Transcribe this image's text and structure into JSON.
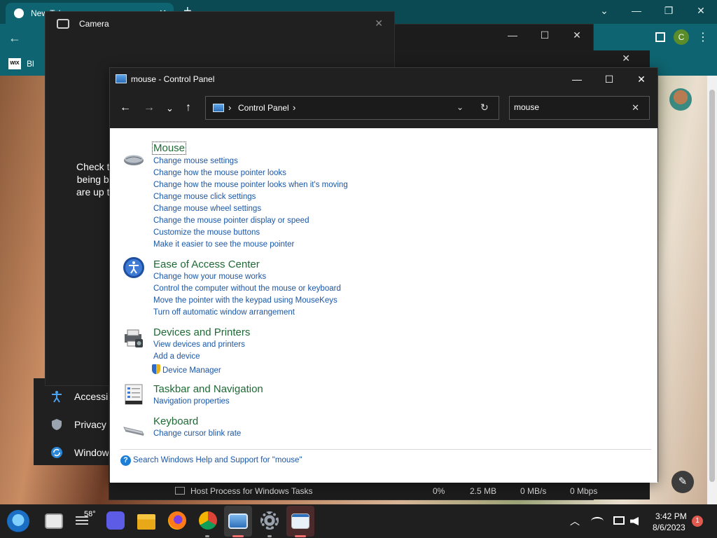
{
  "browser": {
    "tab_title": "New Tab",
    "new_tab": "+",
    "window_buttons": [
      "⌄",
      "—",
      "❐",
      "✕"
    ],
    "back": "←",
    "profile_initial": "C",
    "bookmark_wix": "WIX",
    "bookmark_label": "Bl",
    "menu": "⋮",
    "edit_icon": "✎"
  },
  "camera": {
    "title": "Camera",
    "close": "✕",
    "message_lines": [
      "Check t",
      "being b",
      "are up t"
    ]
  },
  "settings_items": [
    {
      "label": "Accessib",
      "icon": "accessibility-icon"
    },
    {
      "label": "Privacy",
      "icon": "shield-icon"
    },
    {
      "label": "Window",
      "icon": "update-icon"
    }
  ],
  "task_manager": {
    "window_buttons": [
      "—",
      "☐",
      "✕"
    ],
    "close2": "✕",
    "row": {
      "name": "Host Process for Windows Tasks",
      "cpu": "0%",
      "memory": "2.5 MB",
      "disk": "0 MB/s",
      "network": "0 Mbps"
    }
  },
  "control_panel": {
    "title": "mouse - Control Panel",
    "window_buttons": [
      "—",
      "☐",
      "✕"
    ],
    "nav": {
      "back": "←",
      "forward": "→",
      "recent": "⌄",
      "up": "↑"
    },
    "breadcrumb": {
      "sep": "›",
      "location": "Control Panel",
      "sep2": "›",
      "dropdown": "⌄",
      "refresh": "↻"
    },
    "search": {
      "value": "mouse",
      "clear": "✕"
    },
    "results": [
      {
        "title": "Mouse",
        "icon": "mouse-icon",
        "links": [
          "Change mouse settings",
          "Change how the mouse pointer looks",
          "Change how the mouse pointer looks when it's moving",
          "Change mouse click settings",
          "Change mouse wheel settings",
          "Change the mouse pointer display or speed",
          "Customize the mouse buttons",
          "Make it easier to see the mouse pointer"
        ]
      },
      {
        "title": "Ease of Access Center",
        "icon": "ease-of-access-icon",
        "links": [
          "Change how your mouse works",
          "Control the computer without the mouse or keyboard",
          "Move the pointer with the keypad using MouseKeys",
          "Turn off automatic window arrangement"
        ]
      },
      {
        "title": "Devices and Printers",
        "icon": "printer-icon",
        "links": [
          "View devices and printers",
          "Add a device",
          "Device Manager"
        ]
      },
      {
        "title": "Taskbar and Navigation",
        "icon": "taskbar-icon",
        "links": [
          "Navigation properties"
        ]
      },
      {
        "title": "Keyboard",
        "icon": "keyboard-icon",
        "links": [
          "Change cursor blink rate"
        ]
      }
    ],
    "help_icon": "?",
    "help_link": "Search Windows Help and Support for \"mouse\""
  },
  "taskbar": {
    "weather": "58°",
    "time": "3:42 PM",
    "date": "8/6/2023",
    "notification_count": "1",
    "tray": {
      "chevron": "︿"
    }
  }
}
